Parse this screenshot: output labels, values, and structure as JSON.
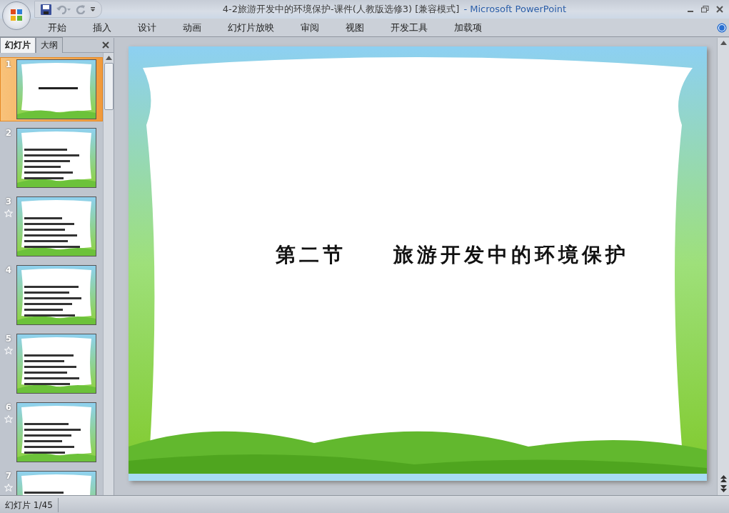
{
  "window": {
    "title": "4-2旅游开发中的环境保护-课件(人教版选修3) [兼容模式]",
    "app_name": "- Microsoft PowerPoint"
  },
  "ribbon_tabs": [
    {
      "label": "开始",
      "selected": false
    },
    {
      "label": "插入",
      "selected": false
    },
    {
      "label": "设计",
      "selected": false
    },
    {
      "label": "动画",
      "selected": false
    },
    {
      "label": "幻灯片放映",
      "selected": false
    },
    {
      "label": "审阅",
      "selected": false
    },
    {
      "label": "视图",
      "selected": false
    },
    {
      "label": "开发工具",
      "selected": false
    },
    {
      "label": "加载项",
      "selected": false
    }
  ],
  "pane_tabs": [
    {
      "label": "幻灯片",
      "selected": true
    },
    {
      "label": "大纲",
      "selected": false
    }
  ],
  "slides": [
    {
      "number": "1",
      "selected": true,
      "animated": false
    },
    {
      "number": "2",
      "selected": false,
      "animated": false
    },
    {
      "number": "3",
      "selected": false,
      "animated": true
    },
    {
      "number": "4",
      "selected": false,
      "animated": false
    },
    {
      "number": "5",
      "selected": false,
      "animated": true
    },
    {
      "number": "6",
      "selected": false,
      "animated": true
    },
    {
      "number": "7",
      "selected": false,
      "animated": true
    }
  ],
  "current_slide": {
    "title": "第二节　　旅游开发中的环境保护"
  },
  "status_bar": {
    "slide_position": "幻灯片 1/45"
  }
}
